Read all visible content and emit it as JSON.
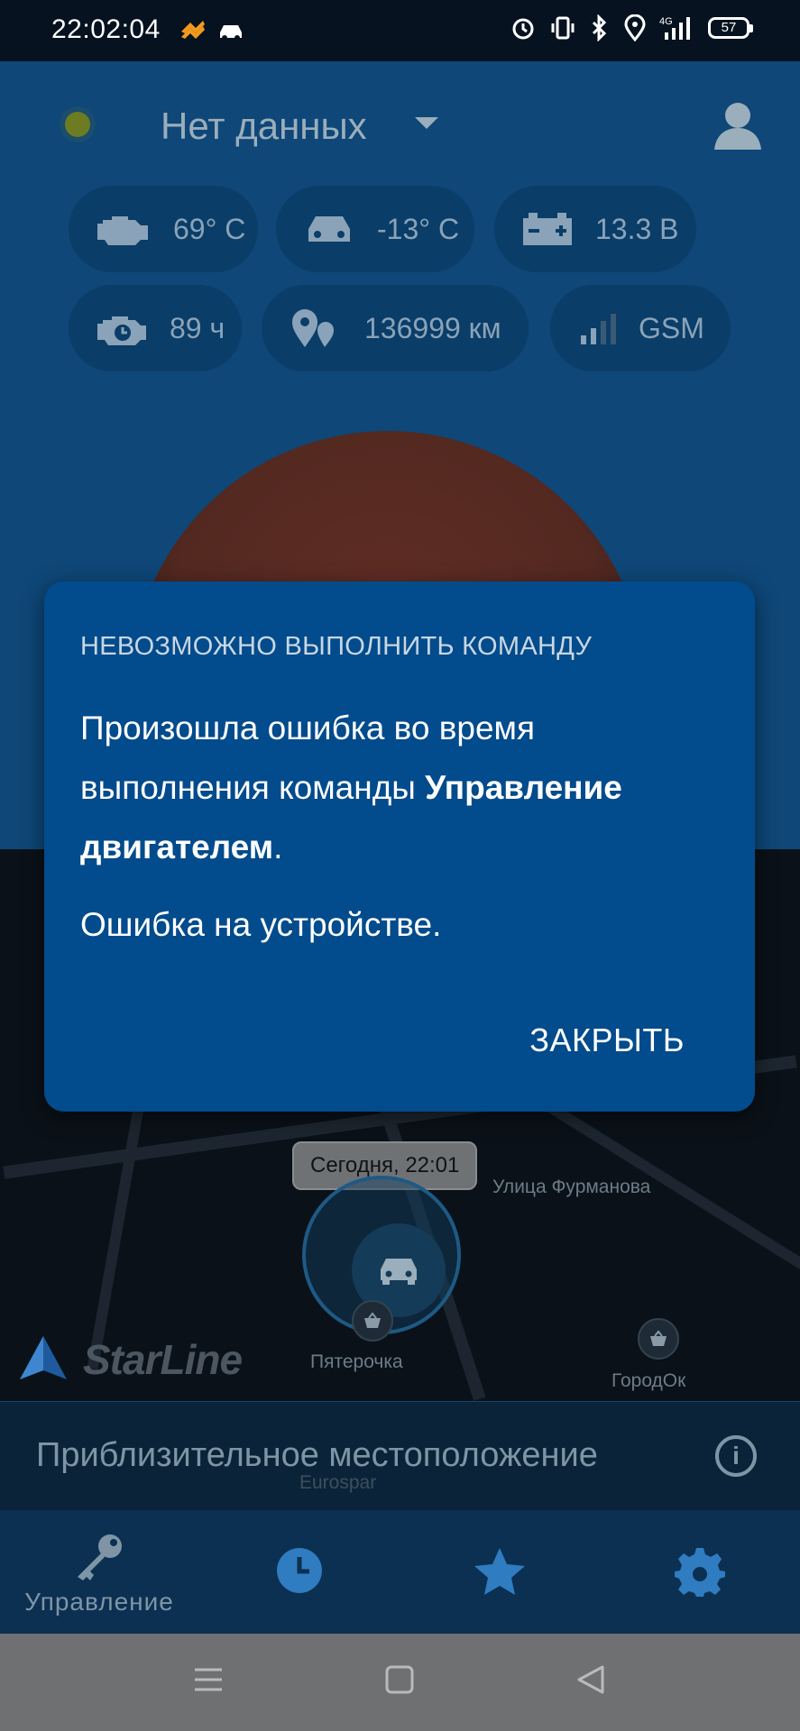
{
  "status_bar": {
    "time": "22:02:04",
    "network": "4G",
    "battery": "57"
  },
  "header": {
    "device_name": "Нет данных"
  },
  "indicators": {
    "engine_temp": "69° C",
    "cabin_temp": "-13° C",
    "voltage": "13.3 В",
    "engine_hours": "89 ч",
    "mileage": "136999 км",
    "signal": "GSM"
  },
  "map": {
    "timestamp": "Сегодня, 22:01",
    "street_label": "Улица Фурманова",
    "poi_1": "Пятерочка",
    "poi_2": "ГородОк",
    "poi_3": "Eurospar",
    "brand": "StarLine"
  },
  "location_bar": {
    "text": "Приблизительное местоположение"
  },
  "bottom_nav": {
    "control_label": "Управление"
  },
  "dialog": {
    "title": "НЕВОЗМОЖНО ВЫПОЛНИТЬ КОМАНДУ",
    "body_prefix": "Произошла ошибка во время выполнения команды ",
    "body_bold": "Управление двигателем",
    "body_suffix": ".",
    "error": "Ошибка на устройстве.",
    "close_label": "ЗАКРЫТЬ"
  },
  "colors": {
    "dialog_bg": "#024b8c",
    "app_bg": "#0e4778",
    "accent": "#2f7cc0"
  }
}
